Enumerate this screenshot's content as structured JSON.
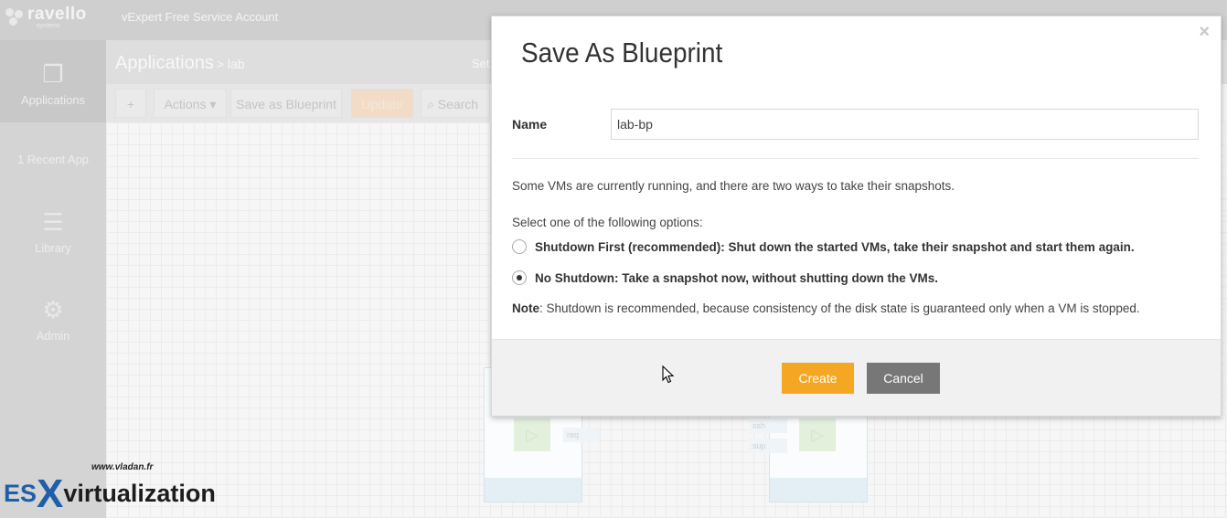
{
  "app": {
    "logo_name": "ravello",
    "logo_sub": "systems",
    "account": "vExpert Free Service Account"
  },
  "sidebar": {
    "items": [
      {
        "label": "Applications",
        "icon": "applications-icon"
      },
      {
        "label": "1 Recent App",
        "icon": ""
      },
      {
        "label": "Library",
        "icon": "library-icon"
      },
      {
        "label": "Admin",
        "icon": "gear-icon"
      }
    ]
  },
  "breadcrumb": {
    "title": "Applications",
    "sub": "> lab",
    "right": "Set"
  },
  "toolbar": {
    "add": "+",
    "actions": "Actions ▾",
    "save_blueprint": "Save as Blueprint",
    "update": "Update",
    "search_placeholder": "Search"
  },
  "canvas": {
    "svc_left": "req",
    "svc_right_1": "ssh",
    "svc_right_2": "sup"
  },
  "modal": {
    "title": "Save As Blueprint",
    "close": "×",
    "name_label": "Name",
    "name_value": "lab-bp",
    "message": "Some VMs are currently running, and there are two ways to take their snapshots.",
    "select_prompt": "Select one of the following options:",
    "option_shutdown": "Shutdown First (recommended): Shut down the started VMs, take their snapshot and start them again.",
    "option_no_shutdown": "No Shutdown: Take a snapshot now, without shutting down the VMs.",
    "selected_option": "no_shutdown",
    "note_label": "Note",
    "note_text": ": Shutdown is recommended, because consistency of the disk state is guaranteed only when a VM is stopped.",
    "create_label": "Create",
    "cancel_label": "Cancel"
  },
  "watermark": {
    "url": "www.vladan.fr",
    "es": "ES",
    "x": "X",
    "rest": "virtualization"
  },
  "colors": {
    "accent": "#f5a623",
    "cancel": "#777777"
  }
}
